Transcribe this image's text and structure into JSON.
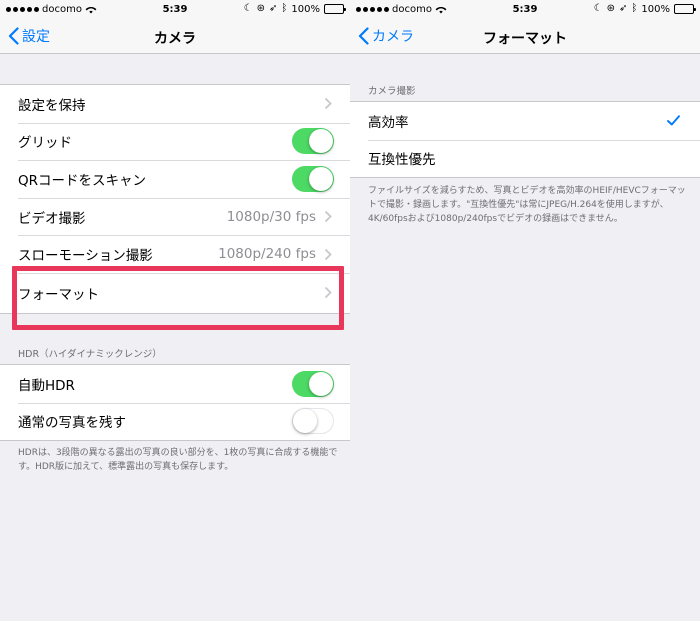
{
  "status_bar": {
    "carrier": "docomo",
    "time": "5:39",
    "battery": "100%",
    "icons": [
      "signal-dots-icon",
      "wifi-icon",
      "moon-icon",
      "orientation-lock-icon",
      "location-arrow-icon",
      "bluetooth-icon",
      "battery-icon"
    ]
  },
  "colors": {
    "accent": "#007aff",
    "toggle_on": "#4cd964",
    "highlight": "#e8375b",
    "background": "#efeff4"
  },
  "left_screen": {
    "back_label": "設定",
    "title": "カメラ",
    "main_group": [
      {
        "label": "設定を保持",
        "value": "",
        "accessory": "chevron"
      },
      {
        "label": "グリッド",
        "value": "",
        "accessory": "toggle-on"
      },
      {
        "label": "QRコードをスキャン",
        "value": "",
        "accessory": "toggle-on"
      },
      {
        "label": "ビデオ撮影",
        "value": "1080p/30 fps",
        "accessory": "chevron"
      },
      {
        "label": "スローモーション撮影",
        "value": "1080p/240 fps",
        "accessory": "chevron"
      },
      {
        "label": "フォーマット",
        "value": "",
        "accessory": "chevron"
      }
    ],
    "hdr_header": "HDR（ハイダイナミックレンジ）",
    "hdr_group": [
      {
        "label": "自動HDR",
        "accessory": "toggle-on"
      },
      {
        "label": "通常の写真を残す",
        "accessory": "toggle-off"
      }
    ],
    "hdr_footer": "HDRは、3段階の異なる露出の写真の良い部分を、1枚の写真に合成する機能です。HDR版に加えて、標準露出の写真も保存します。"
  },
  "right_screen": {
    "back_label": "カメラ",
    "title": "フォーマット",
    "section_header": "カメラ撮影",
    "options": [
      {
        "label": "高効率",
        "selected": true
      },
      {
        "label": "互換性優先",
        "selected": false
      }
    ],
    "footer": "ファイルサイズを減らすため、写真とビデオを高効率のHEIF/HEVCフォーマットで撮影・録画します。\"互換性優先\"は常にJPEG/H.264を使用しますが、4K/60fpsおよび1080p/240fpsでビデオの録画はできません。"
  }
}
